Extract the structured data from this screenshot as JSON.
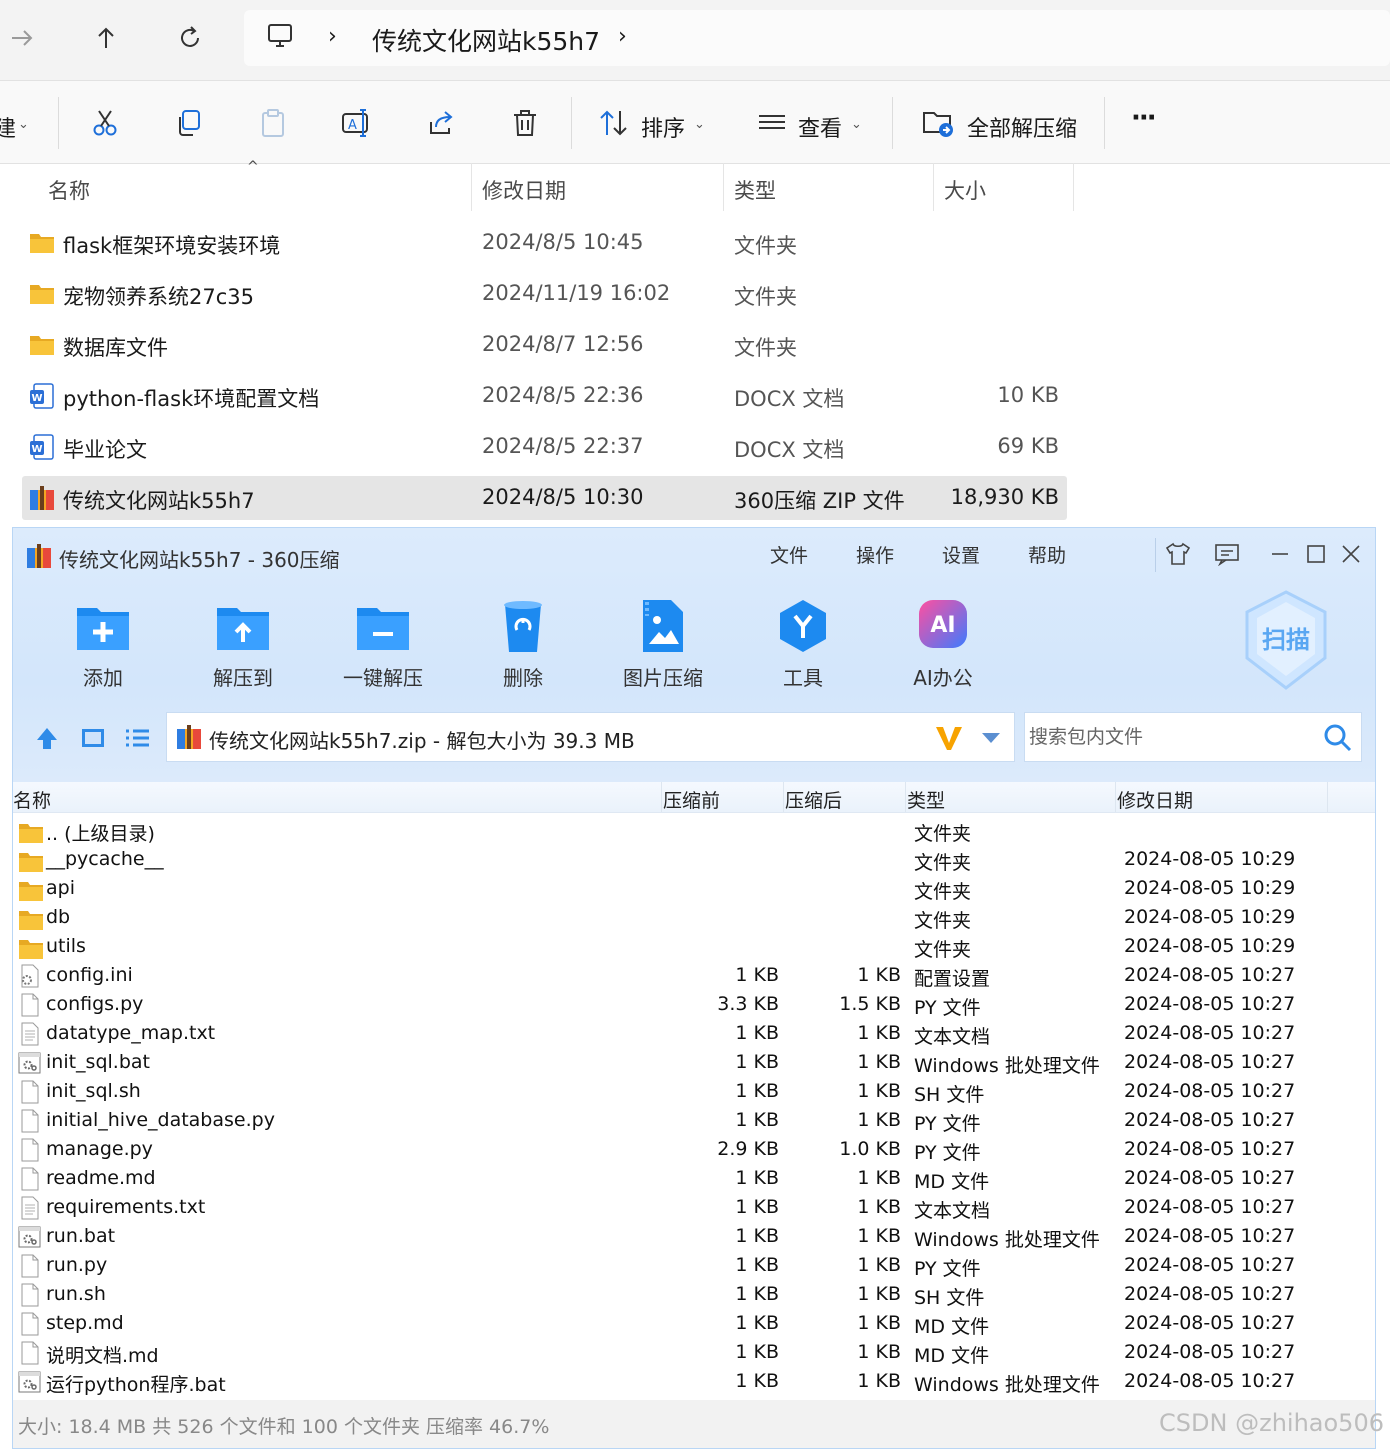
{
  "explorer": {
    "breadcrumb": {
      "sep1": "›",
      "folder": "传统文化网站k55h7",
      "sep2": "›"
    },
    "toolbar": {
      "left_stub": "建",
      "sort_label": "排序",
      "view_label": "查看",
      "extract_all_label": "全部解压缩",
      "more_label": "···"
    },
    "columns": {
      "name": "名称",
      "date": "修改日期",
      "type": "类型",
      "size": "大小"
    },
    "rows": [
      {
        "name": "flask框架环境安装环境",
        "date": "2024/8/5 10:45",
        "type": "文件夹",
        "size": "",
        "icon": "folder-icon"
      },
      {
        "name": "宠物领养系统27c35",
        "date": "2024/11/19 16:02",
        "type": "文件夹",
        "size": "",
        "icon": "folder-icon"
      },
      {
        "name": "数据库文件",
        "date": "2024/8/7 12:56",
        "type": "文件夹",
        "size": "",
        "icon": "folder-icon"
      },
      {
        "name": "python-flask环境配置文档",
        "date": "2024/8/5 22:36",
        "type": "DOCX 文档",
        "size": "10 KB",
        "icon": "word-doc-icon"
      },
      {
        "name": "毕业论文",
        "date": "2024/8/5 22:37",
        "type": "DOCX 文档",
        "size": "69 KB",
        "icon": "word-doc-icon"
      },
      {
        "name": "传统文化网站k55h7",
        "date": "2024/8/5 10:30",
        "type": "360压缩 ZIP 文件",
        "size": "18,930 KB",
        "icon": "zip-archive-icon"
      }
    ]
  },
  "zip_window": {
    "title": "传统文化网站k55h7 - 360压缩",
    "menu": [
      "文件",
      "操作",
      "设置",
      "帮助"
    ],
    "tools": [
      {
        "label": "添加"
      },
      {
        "label": "解压到"
      },
      {
        "label": "一键解压"
      },
      {
        "label": "删除"
      },
      {
        "label": "图片压缩"
      },
      {
        "label": "工具"
      },
      {
        "label": "AI办公"
      }
    ],
    "scan_label": "扫描",
    "ai_icon_text": "AI",
    "path_text": "传统文化网站k55h7.zip - 解包大小为 39.3 MB",
    "search_placeholder": "搜索包内文件",
    "columns": {
      "name": "名称",
      "before": "压缩前",
      "after": "压缩后",
      "type": "类型",
      "date": "修改日期"
    },
    "files": [
      {
        "name": ".. (上级目录)",
        "before": "",
        "after": "",
        "type": "文件夹",
        "date": "",
        "icon": "folder-icon"
      },
      {
        "name": "__pycache__",
        "before": "",
        "after": "",
        "type": "文件夹",
        "date": "2024-08-05 10:29",
        "icon": "folder-icon"
      },
      {
        "name": "api",
        "before": "",
        "after": "",
        "type": "文件夹",
        "date": "2024-08-05 10:29",
        "icon": "folder-icon"
      },
      {
        "name": "db",
        "before": "",
        "after": "",
        "type": "文件夹",
        "date": "2024-08-05 10:29",
        "icon": "folder-icon"
      },
      {
        "name": "utils",
        "before": "",
        "after": "",
        "type": "文件夹",
        "date": "2024-08-05 10:29",
        "icon": "folder-icon"
      },
      {
        "name": "config.ini",
        "before": "1 KB",
        "after": "1 KB",
        "type": "配置设置",
        "date": "2024-08-05 10:27",
        "icon": "config-file-icon"
      },
      {
        "name": "configs.py",
        "before": "3.3 KB",
        "after": "1.5 KB",
        "type": "PY 文件",
        "date": "2024-08-05 10:27",
        "icon": "file-icon"
      },
      {
        "name": "datatype_map.txt",
        "before": "1 KB",
        "after": "1 KB",
        "type": "文本文档",
        "date": "2024-08-05 10:27",
        "icon": "text-file-icon"
      },
      {
        "name": "init_sql.bat",
        "before": "1 KB",
        "after": "1 KB",
        "type": "Windows 批处理文件",
        "date": "2024-08-05 10:27",
        "icon": "batch-file-icon"
      },
      {
        "name": "init_sql.sh",
        "before": "1 KB",
        "after": "1 KB",
        "type": "SH 文件",
        "date": "2024-08-05 10:27",
        "icon": "file-icon"
      },
      {
        "name": "initial_hive_database.py",
        "before": "1 KB",
        "after": "1 KB",
        "type": "PY 文件",
        "date": "2024-08-05 10:27",
        "icon": "file-icon"
      },
      {
        "name": "manage.py",
        "before": "2.9 KB",
        "after": "1.0 KB",
        "type": "PY 文件",
        "date": "2024-08-05 10:27",
        "icon": "file-icon"
      },
      {
        "name": "readme.md",
        "before": "1 KB",
        "after": "1 KB",
        "type": "MD 文件",
        "date": "2024-08-05 10:27",
        "icon": "file-icon"
      },
      {
        "name": "requirements.txt",
        "before": "1 KB",
        "after": "1 KB",
        "type": "文本文档",
        "date": "2024-08-05 10:27",
        "icon": "text-file-icon"
      },
      {
        "name": "run.bat",
        "before": "1 KB",
        "after": "1 KB",
        "type": "Windows 批处理文件",
        "date": "2024-08-05 10:27",
        "icon": "batch-file-icon"
      },
      {
        "name": "run.py",
        "before": "1 KB",
        "after": "1 KB",
        "type": "PY 文件",
        "date": "2024-08-05 10:27",
        "icon": "file-icon"
      },
      {
        "name": "run.sh",
        "before": "1 KB",
        "after": "1 KB",
        "type": "SH 文件",
        "date": "2024-08-05 10:27",
        "icon": "file-icon"
      },
      {
        "name": "step.md",
        "before": "1 KB",
        "after": "1 KB",
        "type": "MD 文件",
        "date": "2024-08-05 10:27",
        "icon": "file-icon"
      },
      {
        "name": "说明文档.md",
        "before": "1 KB",
        "after": "1 KB",
        "type": "MD 文件",
        "date": "2024-08-05 10:27",
        "icon": "file-icon"
      },
      {
        "name": "运行python程序.bat",
        "before": "1 KB",
        "after": "1 KB",
        "type": "Windows 批处理文件",
        "date": "2024-08-05 10:27",
        "icon": "batch-file-icon"
      }
    ],
    "status": "大小: 18.4 MB 共 526 个文件和 100 个文件夹 压缩率 46.7%"
  },
  "watermark": "CSDN @zhihao506",
  "colors": {
    "selection": "#e5e5e5",
    "zip_header_bg": "#dcebfc",
    "accent_blue": "#1e88e5",
    "folder_yellow": "#f8c43a"
  }
}
